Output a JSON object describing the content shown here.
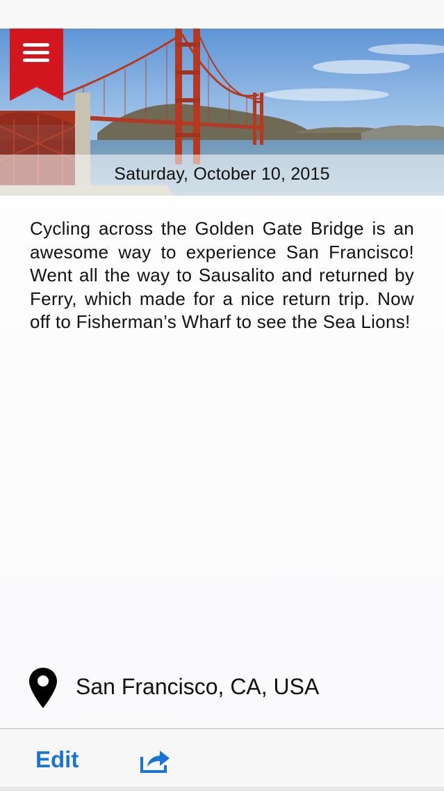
{
  "header": {
    "date": "Saturday, October 10, 2015",
    "photo": "golden-gate-bridge-photo",
    "menu_icon": "hamburger-menu-icon"
  },
  "entry": {
    "text": "Cycling across the Golden Gate Bridge is an awesome way to experience San Francisco! Went all the way to Sausalito and returned by Ferry, which made for a nice return trip. Now off to Fisherman’s Wharf to see the Sea Lions!"
  },
  "location": {
    "icon": "map-pin-icon",
    "label": "San Francisco, CA, USA"
  },
  "toolbar": {
    "edit_label": "Edit",
    "share_icon": "share-icon"
  },
  "colors": {
    "accent": "#1a73d6",
    "ribbon": "#d7191f",
    "text": "#111111"
  }
}
